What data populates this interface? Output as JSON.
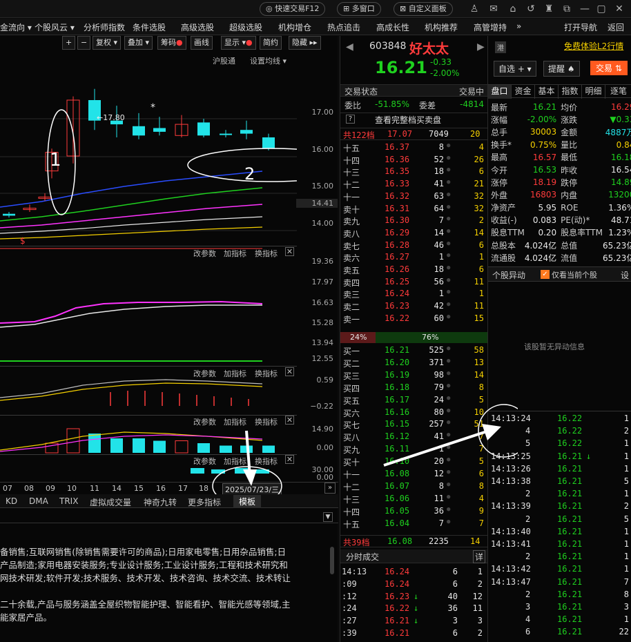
{
  "topbar": {
    "quick_trade": "快速交易F12",
    "multi_window": "多窗口",
    "custom_panel": "自定义面板"
  },
  "menu": [
    "金流向 ▾",
    "个股风云 ▾",
    "分析师指数",
    "条件选股",
    "高级选股",
    "超级选股",
    "机构增仓",
    "热点追击",
    "高成长性",
    "机构推荐",
    "高管增持",
    "»",
    "打开导航",
    "返回"
  ],
  "chart": {
    "toolbar": [
      "+",
      "−",
      "复权 ▾",
      "叠加 ▾",
      "筹码",
      "画线",
      "显示 ▾",
      "简约",
      "隐藏 ▸▸"
    ],
    "links": [
      "沪股通",
      "设置均线 ▾"
    ],
    "peak_label": "←17.80",
    "price_axis": [
      "17.00",
      "16.00",
      "15.00",
      "14.41",
      "14.00"
    ],
    "sub1_axis": [
      "19.36",
      "17.97",
      "16.63",
      "15.28",
      "13.94",
      "12.55"
    ],
    "sub2_axis": [
      "0.59",
      "−0.22"
    ],
    "sub3_axis": [
      "14.90",
      "0.00"
    ],
    "sub4_axis": [
      "30.00",
      "0.00"
    ],
    "panel_actions": [
      "改参数",
      "加指标",
      "换指标"
    ],
    "dates": [
      "07",
      "08",
      "09",
      "10",
      "11",
      "14",
      "15",
      "16",
      "17",
      "18"
    ],
    "date_box": "2025/07/23/三",
    "indicator_tabs": [
      "KD",
      "DMA",
      "TRIX",
      "虚拟成交量",
      "神奇九转",
      "更多指标",
      "模板"
    ],
    "annotation1": "1",
    "annotation2": "2",
    "dollar": "$",
    "candles": [
      {
        "o": 14.45,
        "c": 14.4,
        "h": 14.5,
        "l": 14.35,
        "v": 2
      },
      {
        "o": 14.6,
        "c": 14.6,
        "h": 14.7,
        "l": 14.5,
        "v": 1.5
      },
      {
        "o": 14.9,
        "c": 14.9,
        "h": 15.0,
        "l": 14.8,
        "v": 2
      },
      {
        "o": 15.6,
        "c": 16.1,
        "h": 16.2,
        "l": 15.4,
        "v": 4
      },
      {
        "o": 16.0,
        "c": 17.5,
        "h": 17.6,
        "l": 15.8,
        "v": 10
      },
      {
        "o": 17.5,
        "c": 16.95,
        "h": 17.8,
        "l": 16.7,
        "v": 8
      },
      {
        "o": 16.95,
        "c": 16.85,
        "h": 17.35,
        "l": 16.5,
        "v": 6
      },
      {
        "o": 16.8,
        "c": 16.55,
        "h": 17.15,
        "l": 16.45,
        "v": 6
      },
      {
        "o": 16.75,
        "c": 16.65,
        "h": 17.05,
        "l": 16.55,
        "v": 5
      },
      {
        "o": 16.55,
        "c": 16.85,
        "h": 17.1,
        "l": 16.5,
        "v": 5
      },
      {
        "o": 16.9,
        "c": 16.55,
        "h": 17.0,
        "l": 16.5,
        "v": 4
      },
      {
        "o": 16.6,
        "c": 16.58,
        "h": 16.7,
        "l": 16.5,
        "v": 3
      },
      {
        "o": 16.7,
        "c": 16.6,
        "h": 16.95,
        "l": 16.45,
        "v": 3
      },
      {
        "o": 16.5,
        "c": 16.2,
        "h": 16.6,
        "l": 16.15,
        "v": 3
      }
    ]
  },
  "company_text": {
    "line1": "备销售;互联网销售(除销售需要许可的商品);日用家电零售;日用杂品销售;日",
    "line2": "产品制造;家用电器安装服务;专业设计服务;工业设计服务;工程和技术研究和",
    "line3": "网技术研发;软件开发;技术服务、技术开发、技术咨询、技术交流、技术转让",
    "line4": "二十余载,产品与服务涵盖全屋织物智能护理、智能看护、智能光感等领域,主",
    "line5": "能家居产品。"
  },
  "stock": {
    "code": "603848",
    "name": "好太太",
    "price": "16.21",
    "change": "-0.33",
    "pct": "-2.00%",
    "hk_tag": "港",
    "l2": "免费体验L2行情",
    "watch": "自选 + ▾",
    "alert": "提醒 ♠",
    "trade": "交易 ⇅"
  },
  "orderbook": {
    "header_status": "交易状态",
    "header_trading": "交易中",
    "ratio_label": "委比",
    "ratio": "-51.85%",
    "diff_label": "委差",
    "diff": "-4814",
    "question": "?",
    "full_link": "查看完整档买卖盘",
    "total_sell": "共122档",
    "total_sell_price": "17.07",
    "total_sell_vol": "7049",
    "total_sell_cnt": "20",
    "asks": [
      [
        "十五",
        "16.37",
        "8",
        "4"
      ],
      [
        "十四",
        "16.36",
        "52",
        "26"
      ],
      [
        "十三",
        "16.35",
        "18",
        "6"
      ],
      [
        "十二",
        "16.33",
        "41",
        "21"
      ],
      [
        "十一",
        "16.32",
        "63",
        "32"
      ],
      [
        "卖十",
        "16.31",
        "64",
        "32"
      ],
      [
        "卖九",
        "16.30",
        "7",
        "2"
      ],
      [
        "卖八",
        "16.29",
        "14",
        "14"
      ],
      [
        "卖七",
        "16.28",
        "46",
        "6"
      ],
      [
        "卖六",
        "16.27",
        "1",
        "1"
      ],
      [
        "卖五",
        "16.26",
        "18",
        "6"
      ],
      [
        "卖四",
        "16.25",
        "56",
        "11"
      ],
      [
        "卖三",
        "16.24",
        "1",
        "1"
      ],
      [
        "卖二",
        "16.23",
        "42",
        "11"
      ],
      [
        "卖一",
        "16.22",
        "60",
        "15"
      ]
    ],
    "bar_left": "24%",
    "bar_right": "76%",
    "bids": [
      [
        "买一",
        "16.21",
        "525",
        "58"
      ],
      [
        "买二",
        "16.20",
        "371",
        "13"
      ],
      [
        "买三",
        "16.19",
        "98",
        "14"
      ],
      [
        "买四",
        "16.18",
        "79",
        "8"
      ],
      [
        "买五",
        "16.17",
        "24",
        "5"
      ],
      [
        "买六",
        "16.16",
        "80",
        "10"
      ],
      [
        "买七",
        "16.15",
        "257",
        "51"
      ],
      [
        "买八",
        "16.12",
        "41",
        "7"
      ],
      [
        "买九",
        "16.11",
        "1",
        "7"
      ],
      [
        "买十",
        "16.10",
        "20",
        "5"
      ],
      [
        "十一",
        "16.08",
        "12",
        "6"
      ],
      [
        "十二",
        "16.07",
        "8",
        "8"
      ],
      [
        "十三",
        "16.06",
        "11",
        "4"
      ],
      [
        "十四",
        "16.05",
        "36",
        "9"
      ],
      [
        "十五",
        "16.04",
        "7",
        "7"
      ]
    ],
    "total_buy": "共39档",
    "total_buy_price": "16.08",
    "total_buy_vol": "2235",
    "total_buy_cnt": "14",
    "fen_title": "分时成交",
    "fen_detail": "详",
    "fen": [
      [
        "14:13",
        "16.24",
        "6",
        "1",
        ""
      ],
      [
        ":09",
        "16.24",
        "6",
        "2",
        ""
      ],
      [
        ":12",
        "16.23",
        "40",
        "12",
        "↓"
      ],
      [
        ":24",
        "16.22",
        "36",
        "11",
        "↓"
      ],
      [
        ":27",
        "16.21",
        "3",
        "3",
        "↓"
      ],
      [
        ":39",
        "16.21",
        "6",
        "2",
        ""
      ]
    ]
  },
  "quote": {
    "tabs": [
      "盘口",
      "资金",
      "基本",
      "指数",
      "明细",
      "逐笔"
    ],
    "rows": [
      [
        "最新",
        "16.21",
        "均价",
        "16.29"
      ],
      [
        "涨幅",
        "-2.00%",
        "涨跌",
        "▼0.33"
      ],
      [
        "总手",
        "30003",
        "金额",
        "4887万"
      ],
      [
        "换手*",
        "0.75%",
        "量比",
        "0.84"
      ],
      [
        "最高",
        "16.57",
        "最低",
        "16.18"
      ],
      [
        "今开",
        "16.53",
        "昨收",
        "16.54"
      ],
      [
        "涨停",
        "18.19",
        "跌停",
        "14.89"
      ],
      [
        "外盘",
        "16803",
        "内盘",
        "13200"
      ],
      [
        "净资产",
        "5.95",
        "ROE",
        "1.36%"
      ],
      [
        "收益(-)",
        "0.083",
        "PE(动)*",
        "48.71"
      ],
      [
        "股息TTM",
        "0.20",
        "股息率TTM",
        "1.23%"
      ],
      [
        "总股本",
        "4.024亿",
        "总值",
        "65.23亿"
      ],
      [
        "流通股",
        "4.024亿",
        "流值",
        "65.23亿"
      ]
    ],
    "anomaly_title": "个股异动",
    "anomaly_check": "仅看当前个股",
    "anomaly_set": "设",
    "anomaly_empty": "该股暂无异动信息"
  },
  "ticks": [
    [
      "14:13:24",
      "16.22",
      "",
      "1"
    ],
    [
      "4",
      "16.22",
      "",
      "2"
    ],
    [
      "5",
      "16.22",
      "",
      "1"
    ],
    [
      "14:13:25",
      "16.21",
      "↓",
      "1"
    ],
    [
      "14:13:26",
      "16.21",
      "",
      "1"
    ],
    [
      "14:13:38",
      "16.21",
      "",
      "5"
    ],
    [
      "2",
      "16.21",
      "",
      "1"
    ],
    [
      "14:13:39",
      "16.21",
      "",
      "2"
    ],
    [
      "2",
      "16.21",
      "",
      "5"
    ],
    [
      "14:13:40",
      "16.21",
      "",
      "1"
    ],
    [
      "14:13:41",
      "16.21",
      "",
      "1"
    ],
    [
      "2",
      "16.21",
      "",
      "1"
    ],
    [
      "14:13:42",
      "16.21",
      "",
      "1"
    ],
    [
      "14:13:47",
      "16.21",
      "",
      "7"
    ],
    [
      "2",
      "16.21",
      "",
      "8"
    ],
    [
      "3",
      "16.21",
      "",
      "3"
    ],
    [
      "4",
      "16.21",
      "",
      "1"
    ],
    [
      "6",
      "16.21",
      "",
      "22"
    ]
  ]
}
